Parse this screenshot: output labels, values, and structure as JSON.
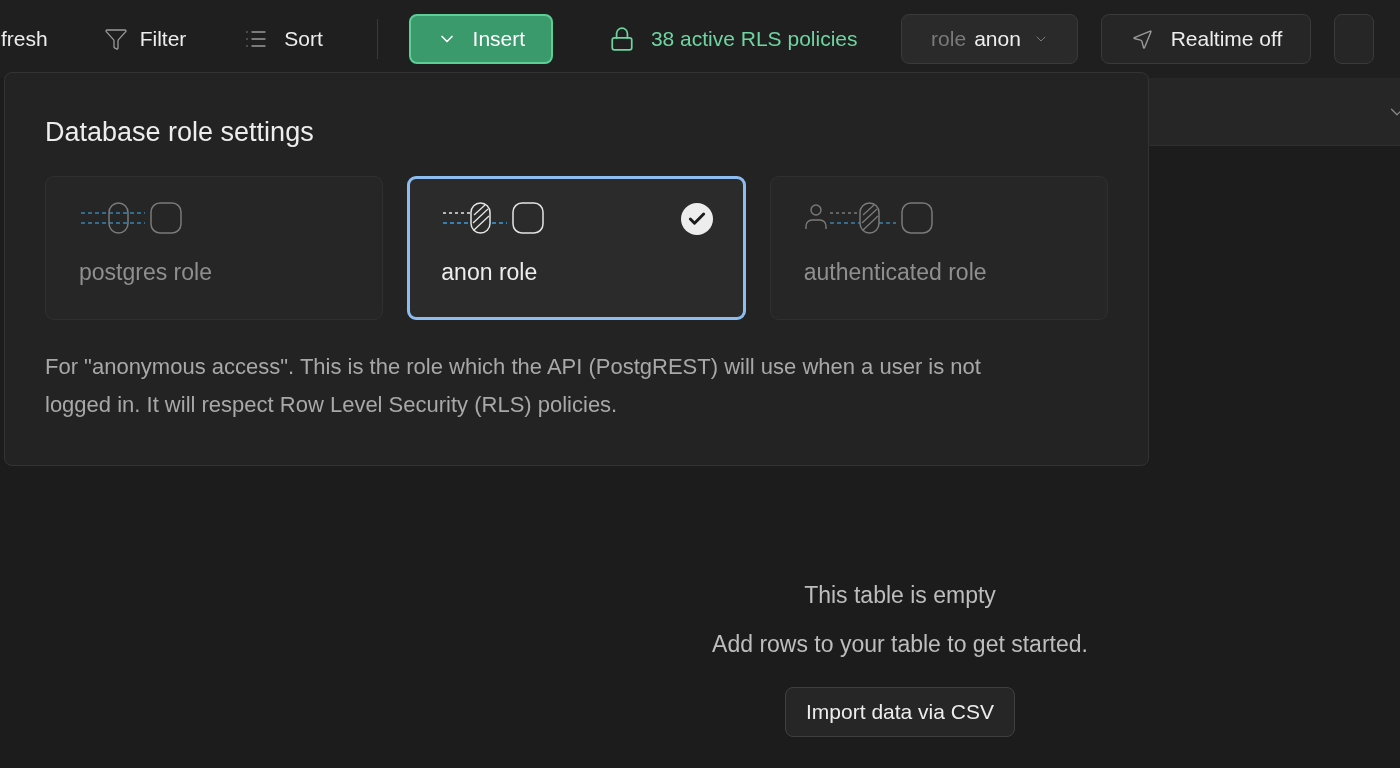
{
  "toolbar": {
    "refresh": {
      "label": "fresh"
    },
    "filter": {
      "label": "Filter"
    },
    "sort": {
      "label": "Sort"
    },
    "insert": {
      "label": "Insert"
    },
    "rls": {
      "label": "38 active RLS policies"
    },
    "role_select": {
      "prefix": "role",
      "value": "anon"
    },
    "realtime": {
      "label": "Realtime off"
    }
  },
  "role_popover": {
    "title": "Database role settings",
    "roles": [
      {
        "kind": "postgres",
        "label": "postgres role",
        "selected": false
      },
      {
        "kind": "anon",
        "label": "anon role",
        "selected": true
      },
      {
        "kind": "authenticated",
        "label": "authenticated role",
        "selected": false
      }
    ],
    "description": "For \"anonymous access\". This is the role which the API (PostgREST) will use when a user is not logged in. It will respect Row Level Security (RLS) policies."
  },
  "empty_state": {
    "title": "This table is empty",
    "subtitle": "Add rows to your table to get started.",
    "button": "Import data via CSV"
  }
}
